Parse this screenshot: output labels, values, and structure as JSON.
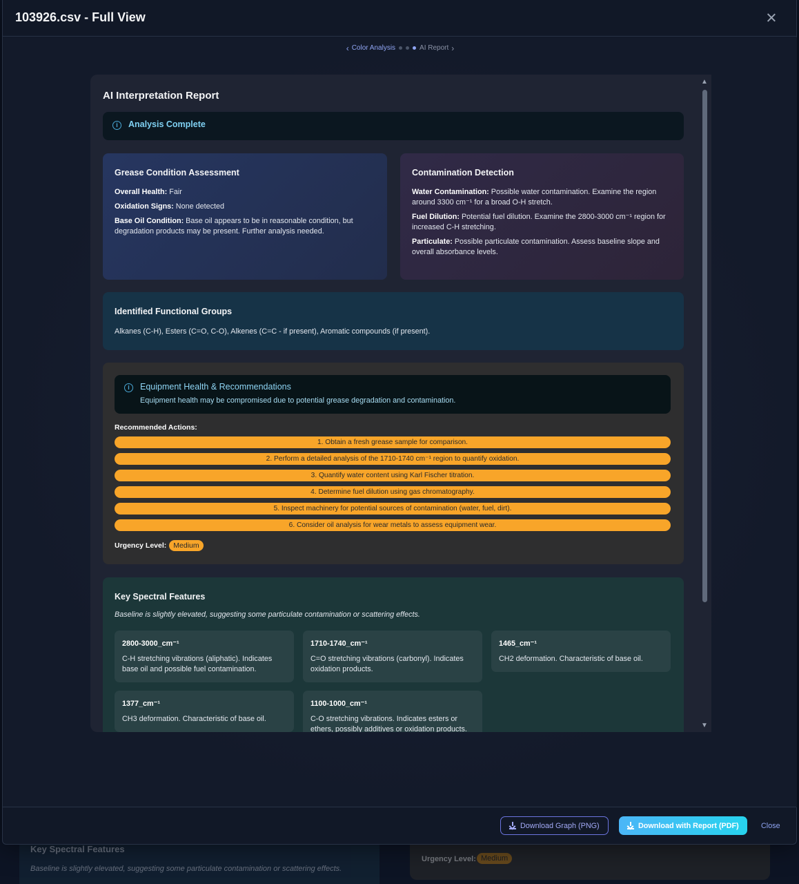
{
  "modal": {
    "title": "103926.csv - Full View"
  },
  "stepper": {
    "prev_label": "Color Analysis",
    "current_label": "AI Report"
  },
  "report": {
    "title": "AI Interpretation Report",
    "status_alert": "Analysis Complete",
    "grease": {
      "title": "Grease Condition Assessment",
      "items": [
        {
          "label": "Overall Health:",
          "value": "Fair"
        },
        {
          "label": "Oxidation Signs:",
          "value": "None detected"
        },
        {
          "label": "Base Oil Condition:",
          "value": "Base oil appears to be in reasonable condition, but degradation products may be present. Further analysis needed."
        }
      ]
    },
    "contamination": {
      "title": "Contamination Detection",
      "items": [
        {
          "label": "Water Contamination:",
          "value": "Possible water contamination. Examine the region around 3300 cm⁻¹ for a broad O-H stretch."
        },
        {
          "label": "Fuel Dilution:",
          "value": "Potential fuel dilution. Examine the 2800-3000 cm⁻¹ region for increased C-H stretching."
        },
        {
          "label": "Particulate:",
          "value": "Possible particulate contamination. Assess baseline slope and overall absorbance levels."
        }
      ]
    },
    "functional_groups": {
      "title": "Identified Functional Groups",
      "text": "Alkanes (C-H), Esters (C=O, C-O), Alkenes (C=C - if present), Aromatic compounds (if present)."
    },
    "equipment": {
      "heading": "Equipment Health & Recommendations",
      "description": "Equipment health may be compromised due to potential grease degradation and contamination.",
      "actions_label": "Recommended Actions:",
      "actions": [
        "1. Obtain a fresh grease sample for comparison.",
        "2. Perform a detailed analysis of the 1710-1740 cm⁻¹ region to quantify oxidation.",
        "3. Quantify water content using Karl Fischer titration.",
        "4. Determine fuel dilution using gas chromatography.",
        "5. Inspect machinery for potential sources of contamination (water, fuel, dirt).",
        "6. Consider oil analysis for wear metals to assess equipment wear."
      ],
      "urgency_label": "Urgency Level:",
      "urgency_value": "Medium"
    },
    "spectral": {
      "title": "Key Spectral Features",
      "subtitle": "Baseline is slightly elevated, suggesting some particulate contamination or scattering effects.",
      "features": [
        {
          "key": "2800-3000_cm⁻¹",
          "value": "C-H stretching vibrations (aliphatic). Indicates base oil and possible fuel contamination."
        },
        {
          "key": "1710-1740_cm⁻¹",
          "value": "C=O stretching vibrations (carbonyl). Indicates oxidation products."
        },
        {
          "key": "1465_cm⁻¹",
          "value": "CH2 deformation. Characteristic of base oil."
        },
        {
          "key": "1377_cm⁻¹",
          "value": "CH3 deformation. Characteristic of base oil."
        },
        {
          "key": "1100-1000_cm⁻¹",
          "value": "C-O stretching vibrations. Indicates esters or ethers, possibly additives or oxidation products."
        }
      ]
    }
  },
  "footer": {
    "download_graph": "Download Graph (PNG)",
    "download_report": "Download with Report (PDF)",
    "close": "Close"
  },
  "background": {
    "spectral_title": "Key Spectral Features",
    "spectral_subtitle": "Baseline is slightly elevated, suggesting some particulate contamination or scattering effects.",
    "urgency_label": "Urgency Level:",
    "urgency_value": "Medium"
  },
  "colors": {
    "accent": "#8fa4f2",
    "action_pill": "#f8a529",
    "primary_button": "#27d3ee"
  }
}
